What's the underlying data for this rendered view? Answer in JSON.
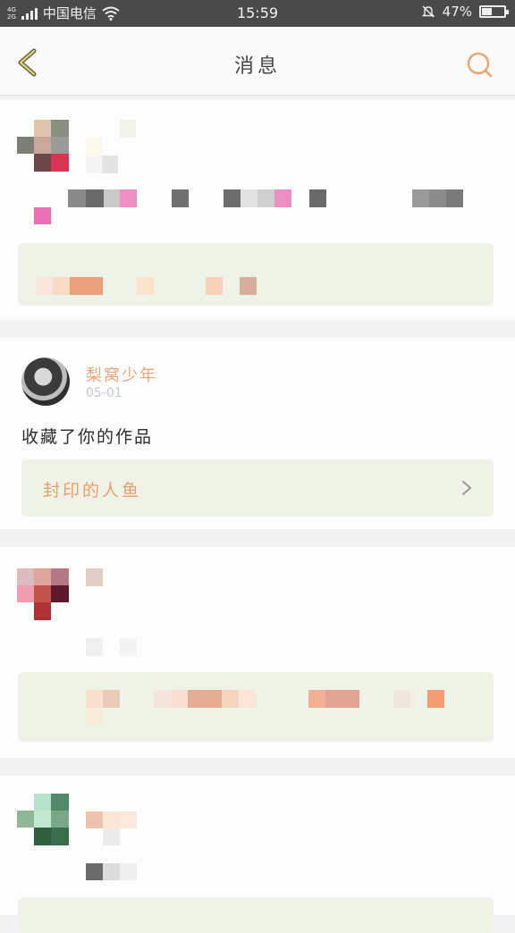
{
  "status_bar": {
    "network": "4G\n2G",
    "carrier": "中国电信",
    "time": "15:59",
    "battery": "47%",
    "battery_level": 0.47
  },
  "header": {
    "title": "消息",
    "back_icon": "chevron-left-icon",
    "search_icon": "search-icon",
    "accent_color": "#f0a46e"
  },
  "messages": [
    {
      "user_name": "梨窝少年",
      "date": "05-01",
      "action_text": "收藏了你的作品",
      "work_title": "封印的人鱼"
    }
  ],
  "colors": {
    "name": "#e9a47b",
    "work_box": "#eff2e6",
    "background": "#f3f3f3"
  }
}
